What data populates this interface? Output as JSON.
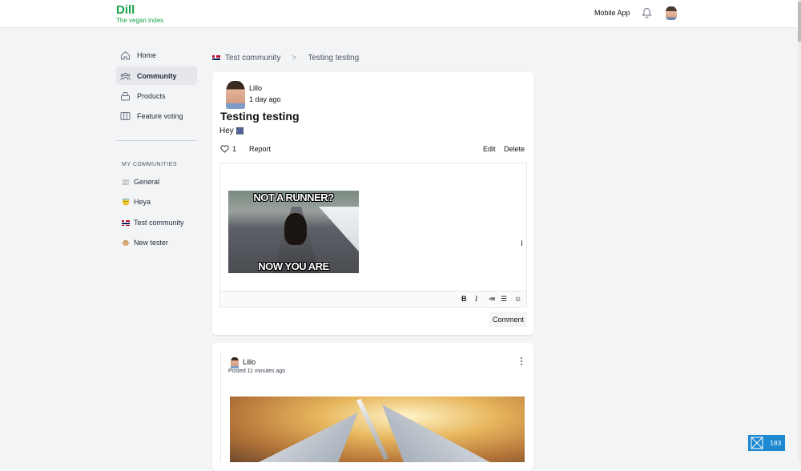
{
  "header": {
    "logo": "Dill",
    "tagline": "The vegan index",
    "mobile_app": "Mobile App"
  },
  "sidebar": {
    "items": [
      {
        "label": "Home",
        "icon": "home-icon"
      },
      {
        "label": "Community",
        "icon": "community-icon",
        "active": true
      },
      {
        "label": "Products",
        "icon": "products-icon"
      },
      {
        "label": "Feature voting",
        "icon": "feature-voting-icon"
      }
    ],
    "section_label": "MY COMMUNITIES",
    "communities": [
      {
        "label": "General",
        "emoji": "📰"
      },
      {
        "label": "Heya",
        "emoji": "😇"
      },
      {
        "label": "Test community",
        "emoji": "flag-norway"
      },
      {
        "label": "New tester",
        "emoji": "🐵"
      }
    ]
  },
  "breadcrumb": {
    "community": "Test community",
    "separator": ">",
    "current": "Testing testing"
  },
  "post": {
    "author": "Lillo",
    "time": "1 day ago",
    "title": "Testing testing",
    "body": "Hey",
    "body_emoji": "🎆",
    "likes": "1",
    "report": "Report",
    "edit": "Edit",
    "delete": "Delete"
  },
  "editor": {
    "meme_top": "NOT A RUNNER?",
    "meme_bottom": "NOW YOU ARE",
    "toolbar": {
      "bold": "B",
      "italic": "I",
      "ordered_list": "≔",
      "bullet_list": "☰",
      "emoji": "☺"
    },
    "comment_button": "Comment"
  },
  "comment": {
    "author": "Lillo",
    "posted": "Posted 11 minutes ago"
  },
  "badge": {
    "count": "103"
  }
}
